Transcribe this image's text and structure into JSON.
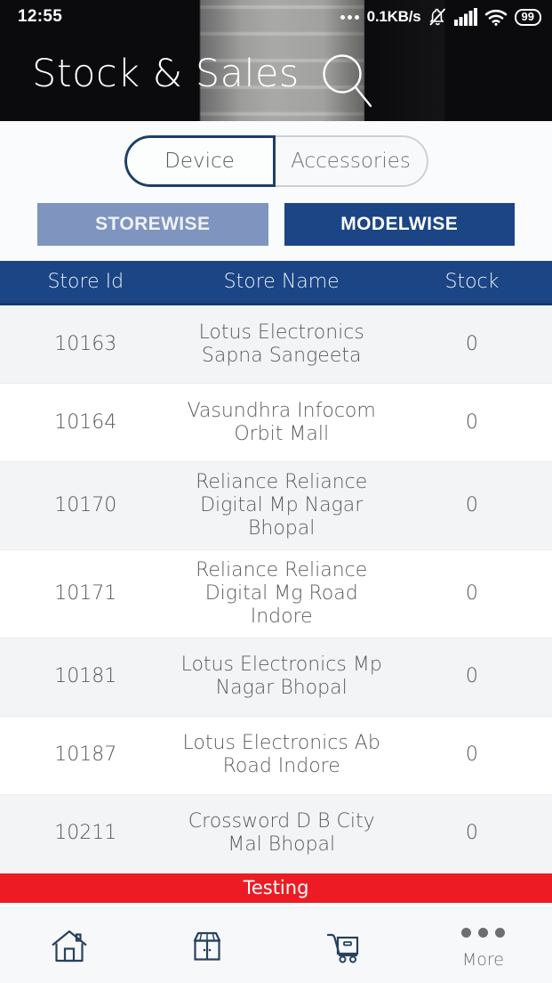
{
  "statusbar": {
    "time": "12:55",
    "network_speed": "0.1KB/s",
    "battery_level": "99",
    "icons": [
      "overflow-dots",
      "bell-muted-icon",
      "signal-bars-icon",
      "wifi-icon",
      "battery-icon"
    ]
  },
  "header": {
    "title": "Stock & Sales",
    "search_icon": "search-icon"
  },
  "segmented": {
    "items": [
      {
        "label": "Device",
        "selected": true
      },
      {
        "label": "Accessories",
        "selected": false
      }
    ]
  },
  "mode_buttons": {
    "storewise": "STOREWISE",
    "modelwise": "MODELWISE",
    "active": "MODELWISE",
    "inactive_color": "#7f95c0",
    "active_color": "#1b4584"
  },
  "table": {
    "columns": [
      "Store Id",
      "Store Name",
      "Stock"
    ],
    "rows": [
      {
        "store_id": "10163",
        "store_name": "Lotus Electronics Sapna Sangeeta",
        "stock": "0"
      },
      {
        "store_id": "10164",
        "store_name": "Vasundhra Infocom Orbit Mall",
        "stock": "0"
      },
      {
        "store_id": "10170",
        "store_name": "Reliance Reliance Digital Mp Nagar Bhopal",
        "stock": "0"
      },
      {
        "store_id": "10171",
        "store_name": "Reliance Reliance Digital Mg Road Indore",
        "stock": "0"
      },
      {
        "store_id": "10181",
        "store_name": "Lotus Electronics Mp Nagar Bhopal",
        "stock": "0"
      },
      {
        "store_id": "10187",
        "store_name": "Lotus Electronics Ab Road Indore",
        "stock": "0"
      },
      {
        "store_id": "10211",
        "store_name": "Crossword D B City Mal Bhopal",
        "stock": "0"
      }
    ]
  },
  "banner": {
    "text": "Testing",
    "color": "#ed1c24"
  },
  "bottomnav": {
    "items": [
      {
        "icon": "home-icon",
        "label": ""
      },
      {
        "icon": "store-icon",
        "label": ""
      },
      {
        "icon": "cart-icon",
        "label": ""
      },
      {
        "icon": "more-dots-icon",
        "label": "More"
      }
    ]
  }
}
